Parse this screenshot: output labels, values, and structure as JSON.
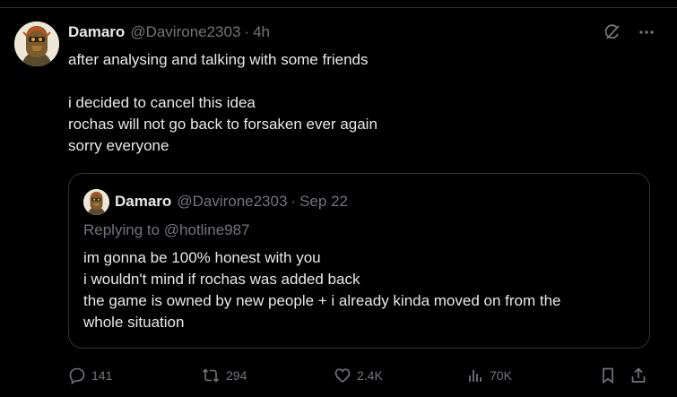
{
  "tweet": {
    "author_name": "Damaro",
    "author_handle": "@Davirone2303",
    "separator": "·",
    "time": "4h",
    "lines": [
      "after analysing and talking with some friends",
      "i decided to cancel this idea",
      "rochas will not go back to forsaken ever again",
      "sorry everyone"
    ]
  },
  "quote": {
    "author_name": "Damaro",
    "author_handle": "@Davirone2303",
    "separator": "·",
    "date": "Sep 22",
    "replying_prefix": "Replying to",
    "replying_handle": "@hotline987",
    "lines": [
      "im gonna be 100% honest with you",
      "i wouldn't mind if rochas was added back",
      "the game is owned by new people + i already kinda moved on from the",
      "whole situation"
    ]
  },
  "actions": {
    "replies": "141",
    "reposts": "294",
    "likes": "2.4K",
    "views": "70K"
  },
  "icons": [
    "grok-icon",
    "more-icon",
    "reply-icon",
    "repost-icon",
    "like-icon",
    "views-icon",
    "bookmark-icon",
    "share-icon"
  ],
  "colors": {
    "background": "#000000",
    "text": "#e7e9ea",
    "secondary": "#71767b",
    "border": "#2f3336"
  }
}
